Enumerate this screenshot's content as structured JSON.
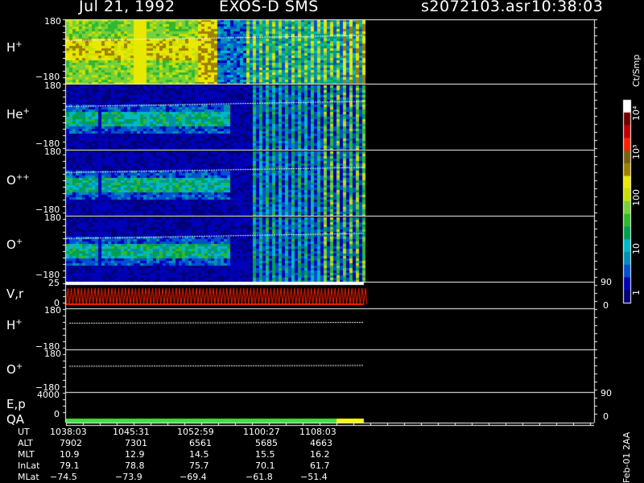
{
  "header": {
    "date": "Jul 21, 1992",
    "instrument": "EXOS-D SMS",
    "file": "s2072103.asr",
    "time": "10:38:03"
  },
  "panels": [
    {
      "label": "H",
      "sup": "+",
      "ymax": "180",
      "ymin": "−180"
    },
    {
      "label": "He",
      "sup": "+",
      "ymax": "180",
      "ymin": "−180"
    },
    {
      "label": "O",
      "sup": "++",
      "ymax": "180",
      "ymin": "−180"
    },
    {
      "label": "O",
      "sup": "+",
      "ymax": "180",
      "ymin": "−180"
    },
    {
      "label": "V,r",
      "sup": "",
      "ymax": "25",
      "ymin": "0",
      "rmax": "90",
      "rmin": "0"
    },
    {
      "label": "H",
      "sup": "+",
      "ymax": "180",
      "ymin": "−180"
    },
    {
      "label": "O",
      "sup": "+",
      "ymax": "180",
      "ymin": "−180"
    },
    {
      "label": "E,p",
      "sup": "",
      "ymax": "4000",
      "ymin": "0",
      "rmax": "90",
      "rmin": "0"
    },
    {
      "label": "QA",
      "sup": ""
    }
  ],
  "colorbar": {
    "unit": "Ct/Smp",
    "labels": [
      "10⁴",
      "10³",
      "100",
      "10",
      "1"
    ]
  },
  "footer": {
    "rows": [
      {
        "name": "UT",
        "values": [
          "1038:03",
          "1045:31",
          "1052:59",
          "1100:27",
          "1108:03"
        ]
      },
      {
        "name": "ALT",
        "values": [
          "7902",
          "7301",
          "6561",
          "5685",
          "4663"
        ]
      },
      {
        "name": "MLT",
        "values": [
          "10.9",
          "12.9",
          "14.5",
          "15.5",
          "16.2"
        ]
      },
      {
        "name": "InLat",
        "values": [
          "79.1",
          "78.8",
          "75.7",
          "70.1",
          "61.7"
        ]
      },
      {
        "name": "MLat",
        "values": [
          "−74.5",
          "−73.9",
          "−69.4",
          "−61.8",
          "−51.4"
        ]
      }
    ],
    "stamp": "Feb-01 2AA"
  },
  "chart_data": {
    "type": "heatmap",
    "title": "Jul 21, 1992    EXOS-D SMS",
    "xlabel": "UT",
    "x_ticks": [
      "1038:03",
      "1045:31",
      "1052:59",
      "1100:27",
      "1108:03"
    ],
    "series": [
      {
        "name": "H+",
        "ylim": [
          -180,
          180
        ]
      },
      {
        "name": "He+",
        "ylim": [
          -180,
          180
        ]
      },
      {
        "name": "O++",
        "ylim": [
          -180,
          180
        ]
      },
      {
        "name": "O+",
        "ylim": [
          -180,
          180
        ]
      },
      {
        "name": "V,r",
        "ylim": [
          0,
          25
        ],
        "right_ylim": [
          0,
          90
        ]
      },
      {
        "name": "H+",
        "ylim": [
          -180,
          180
        ]
      },
      {
        "name": "O+",
        "ylim": [
          -180,
          180
        ]
      },
      {
        "name": "E,p",
        "ylim": [
          0,
          4000
        ],
        "right_ylim": [
          0,
          90
        ]
      }
    ],
    "colorbar": {
      "unit": "Ct/Smp",
      "scale": "log",
      "range": [
        1,
        10000
      ]
    },
    "colormap": [
      "#00007a",
      "#0000b8",
      "#0050d0",
      "#0090b8",
      "#00b8c8",
      "#00a050",
      "#30b830",
      "#78d038",
      "#c8e000",
      "#e8e800",
      "#a08000",
      "#786010",
      "#ff2000",
      "#c00000",
      "#700000",
      "#ffffff"
    ],
    "qa": {
      "good_color": "#40e040",
      "warn_color": "#ffff00"
    }
  }
}
